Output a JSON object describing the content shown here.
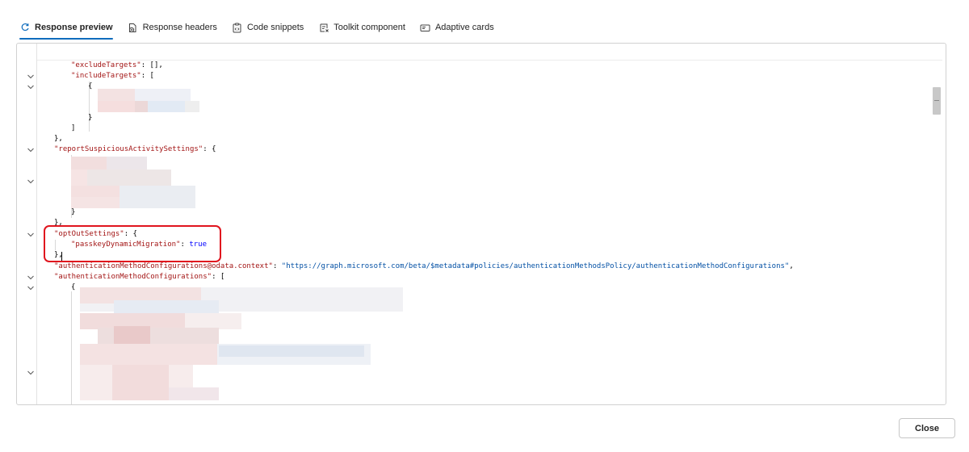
{
  "tabs": [
    {
      "label": "Response preview",
      "icon": "response-preview-icon",
      "active": true
    },
    {
      "label": "Response headers",
      "icon": "response-headers-icon",
      "active": false
    },
    {
      "label": "Code snippets",
      "icon": "code-snippets-icon",
      "active": false
    },
    {
      "label": "Toolkit component",
      "icon": "toolkit-component-icon",
      "active": false
    },
    {
      "label": "Adaptive cards",
      "icon": "adaptive-cards-icon",
      "active": false
    }
  ],
  "code": {
    "excludeTargets_key": "\"excludeTargets\"",
    "excludeTargets_tail": ": [],",
    "includeTargets_key": "\"includeTargets\"",
    "includeTargets_tail": ": [",
    "open_brace": "{",
    "close_brace": "}",
    "close_bracket": "]",
    "close_brace_comma": "},",
    "report_key": "\"reportSuspiciousActivitySettings\"",
    "report_tail": ": {",
    "optout_key": "\"optOutSettings\"",
    "optout_tail": ": {",
    "passkey_key": "\"passkeyDynamicMigration\"",
    "passkey_colon": ": ",
    "passkey_value": "true",
    "context_key": "\"authenticationMethodConfigurations@odata.context\"",
    "context_colon": ": ",
    "context_value": "\"https://graph.microsoft.com/beta/$metadata#policies/authenticationMethodsPolicy/authenticationMethodConfigurations\"",
    "context_comma": ",",
    "configs_key": "\"authenticationMethodConfigurations\"",
    "configs_tail": ": ["
  },
  "footer": {
    "close_label": "Close"
  },
  "colors": {
    "accent": "#0f6cbd",
    "highlight": "#e0141e",
    "json_key": "#a31515",
    "json_string": "#0451a5",
    "json_bool": "#0000ff"
  }
}
